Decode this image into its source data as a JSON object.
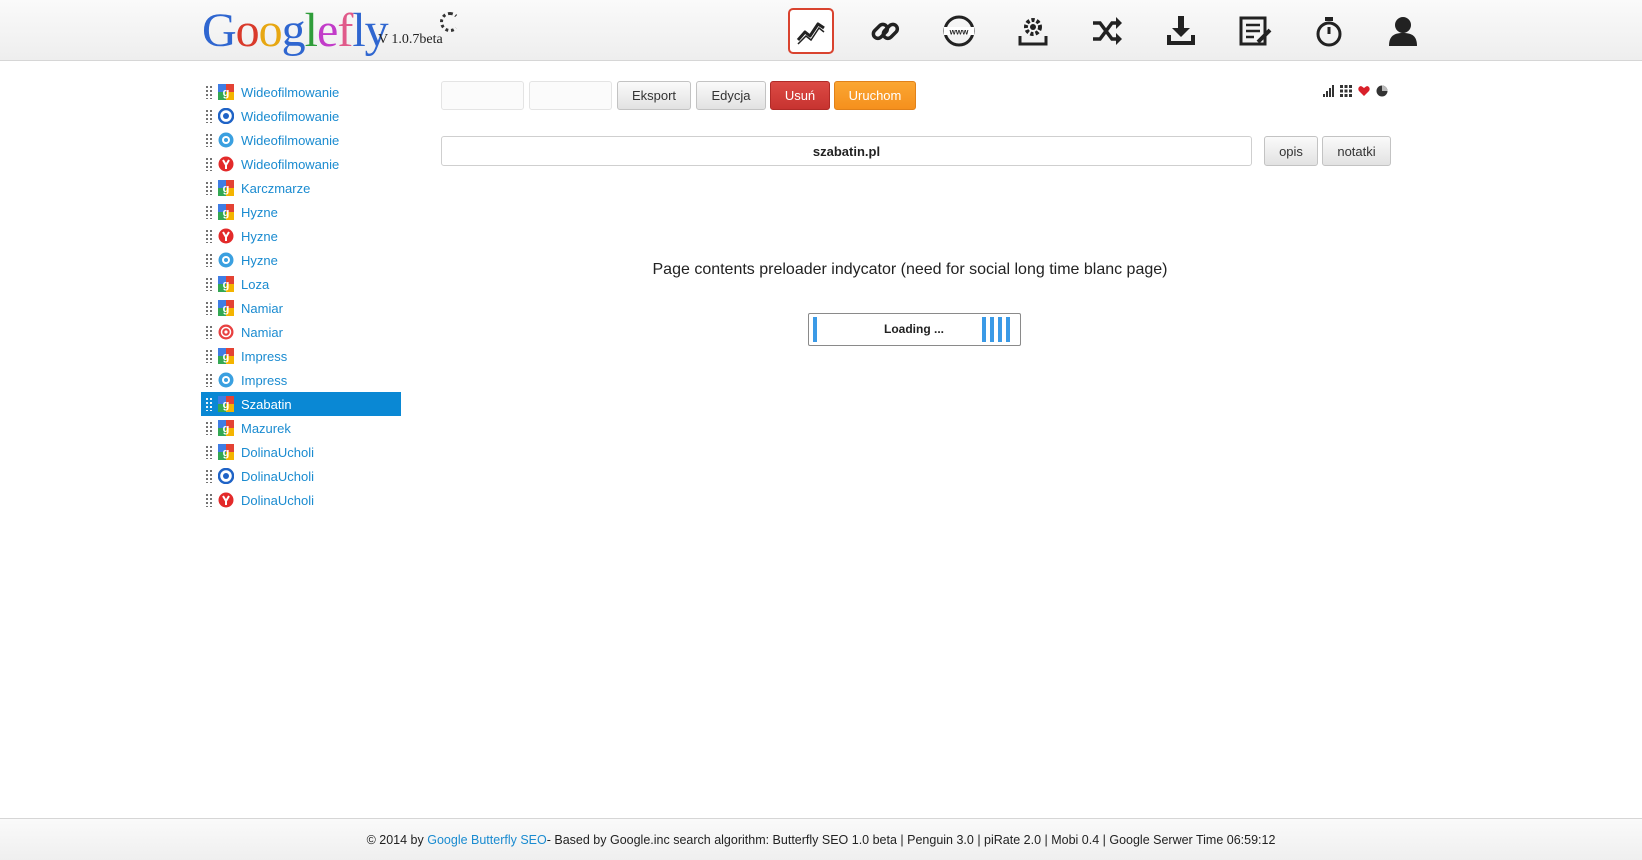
{
  "header": {
    "logo_text": "Googlefly",
    "version": "V 1.0.7beta",
    "nav": [
      {
        "icon": "chart-line-icon",
        "active": true
      },
      {
        "icon": "link-icon",
        "active": false
      },
      {
        "icon": "www-globe-icon",
        "active": false
      },
      {
        "icon": "gear-icon",
        "active": false
      },
      {
        "icon": "shuffle-icon",
        "active": false
      },
      {
        "icon": "download-icon",
        "active": false
      },
      {
        "icon": "edit-list-icon",
        "active": false
      },
      {
        "icon": "stopwatch-icon",
        "active": false
      },
      {
        "icon": "user-icon",
        "active": false
      }
    ]
  },
  "sidebar": {
    "items": [
      {
        "label": "Wideofilmowanie",
        "engine": "google",
        "active": false
      },
      {
        "label": "Wideofilmowanie",
        "engine": "bing",
        "active": false
      },
      {
        "label": "Wideofilmowanie",
        "engine": "onet",
        "active": false
      },
      {
        "label": "Wideofilmowanie",
        "engine": "yandex",
        "active": false
      },
      {
        "label": "Karczmarze",
        "engine": "google",
        "active": false
      },
      {
        "label": "Hyzne",
        "engine": "google",
        "active": false
      },
      {
        "label": "Hyzne",
        "engine": "yandex",
        "active": false
      },
      {
        "label": "Hyzne",
        "engine": "onet",
        "active": false
      },
      {
        "label": "Loza",
        "engine": "google",
        "active": false
      },
      {
        "label": "Namiar",
        "engine": "google",
        "active": false
      },
      {
        "label": "Namiar",
        "engine": "other",
        "active": false
      },
      {
        "label": "Impress",
        "engine": "google",
        "active": false
      },
      {
        "label": "Impress",
        "engine": "onet",
        "active": false
      },
      {
        "label": "Szabatin",
        "engine": "google",
        "active": true
      },
      {
        "label": "Mazurek",
        "engine": "google",
        "active": false
      },
      {
        "label": "DolinaUcholi",
        "engine": "google",
        "active": false
      },
      {
        "label": "DolinaUcholi",
        "engine": "bing",
        "active": false
      },
      {
        "label": "DolinaUcholi",
        "engine": "yandex",
        "active": false
      }
    ]
  },
  "toolbar": {
    "export_label": "Eksport",
    "edit_label": "Edycja",
    "delete_label": "Usuń",
    "run_label": "Uruchom",
    "mini_icons": [
      "signal-bars-icon",
      "grid-icon",
      "heart-icon",
      "pie-icon"
    ]
  },
  "domain": {
    "value": "szabatin.pl",
    "opis_label": "opis",
    "notatki_label": "notatki"
  },
  "main": {
    "preloader_text": "Page contents preloader indycator (need for social long time blanc page)",
    "loading_label": "Loading ..."
  },
  "footer": {
    "prefix": "© 2014 by ",
    "link": "Google Butterfly SEO",
    "suffix": " - Based by Google.inc search algorithm: Butterfly SEO 1.0 beta | Penguin 3.0 | piRate 2.0 | Mobi 0.4 | Google Serwer Time 06:59:12"
  },
  "colors": {
    "accent": "#1a8bd0",
    "active_bg": "#0a88d4",
    "danger": "#d9432f",
    "warning": "#f5901d"
  }
}
